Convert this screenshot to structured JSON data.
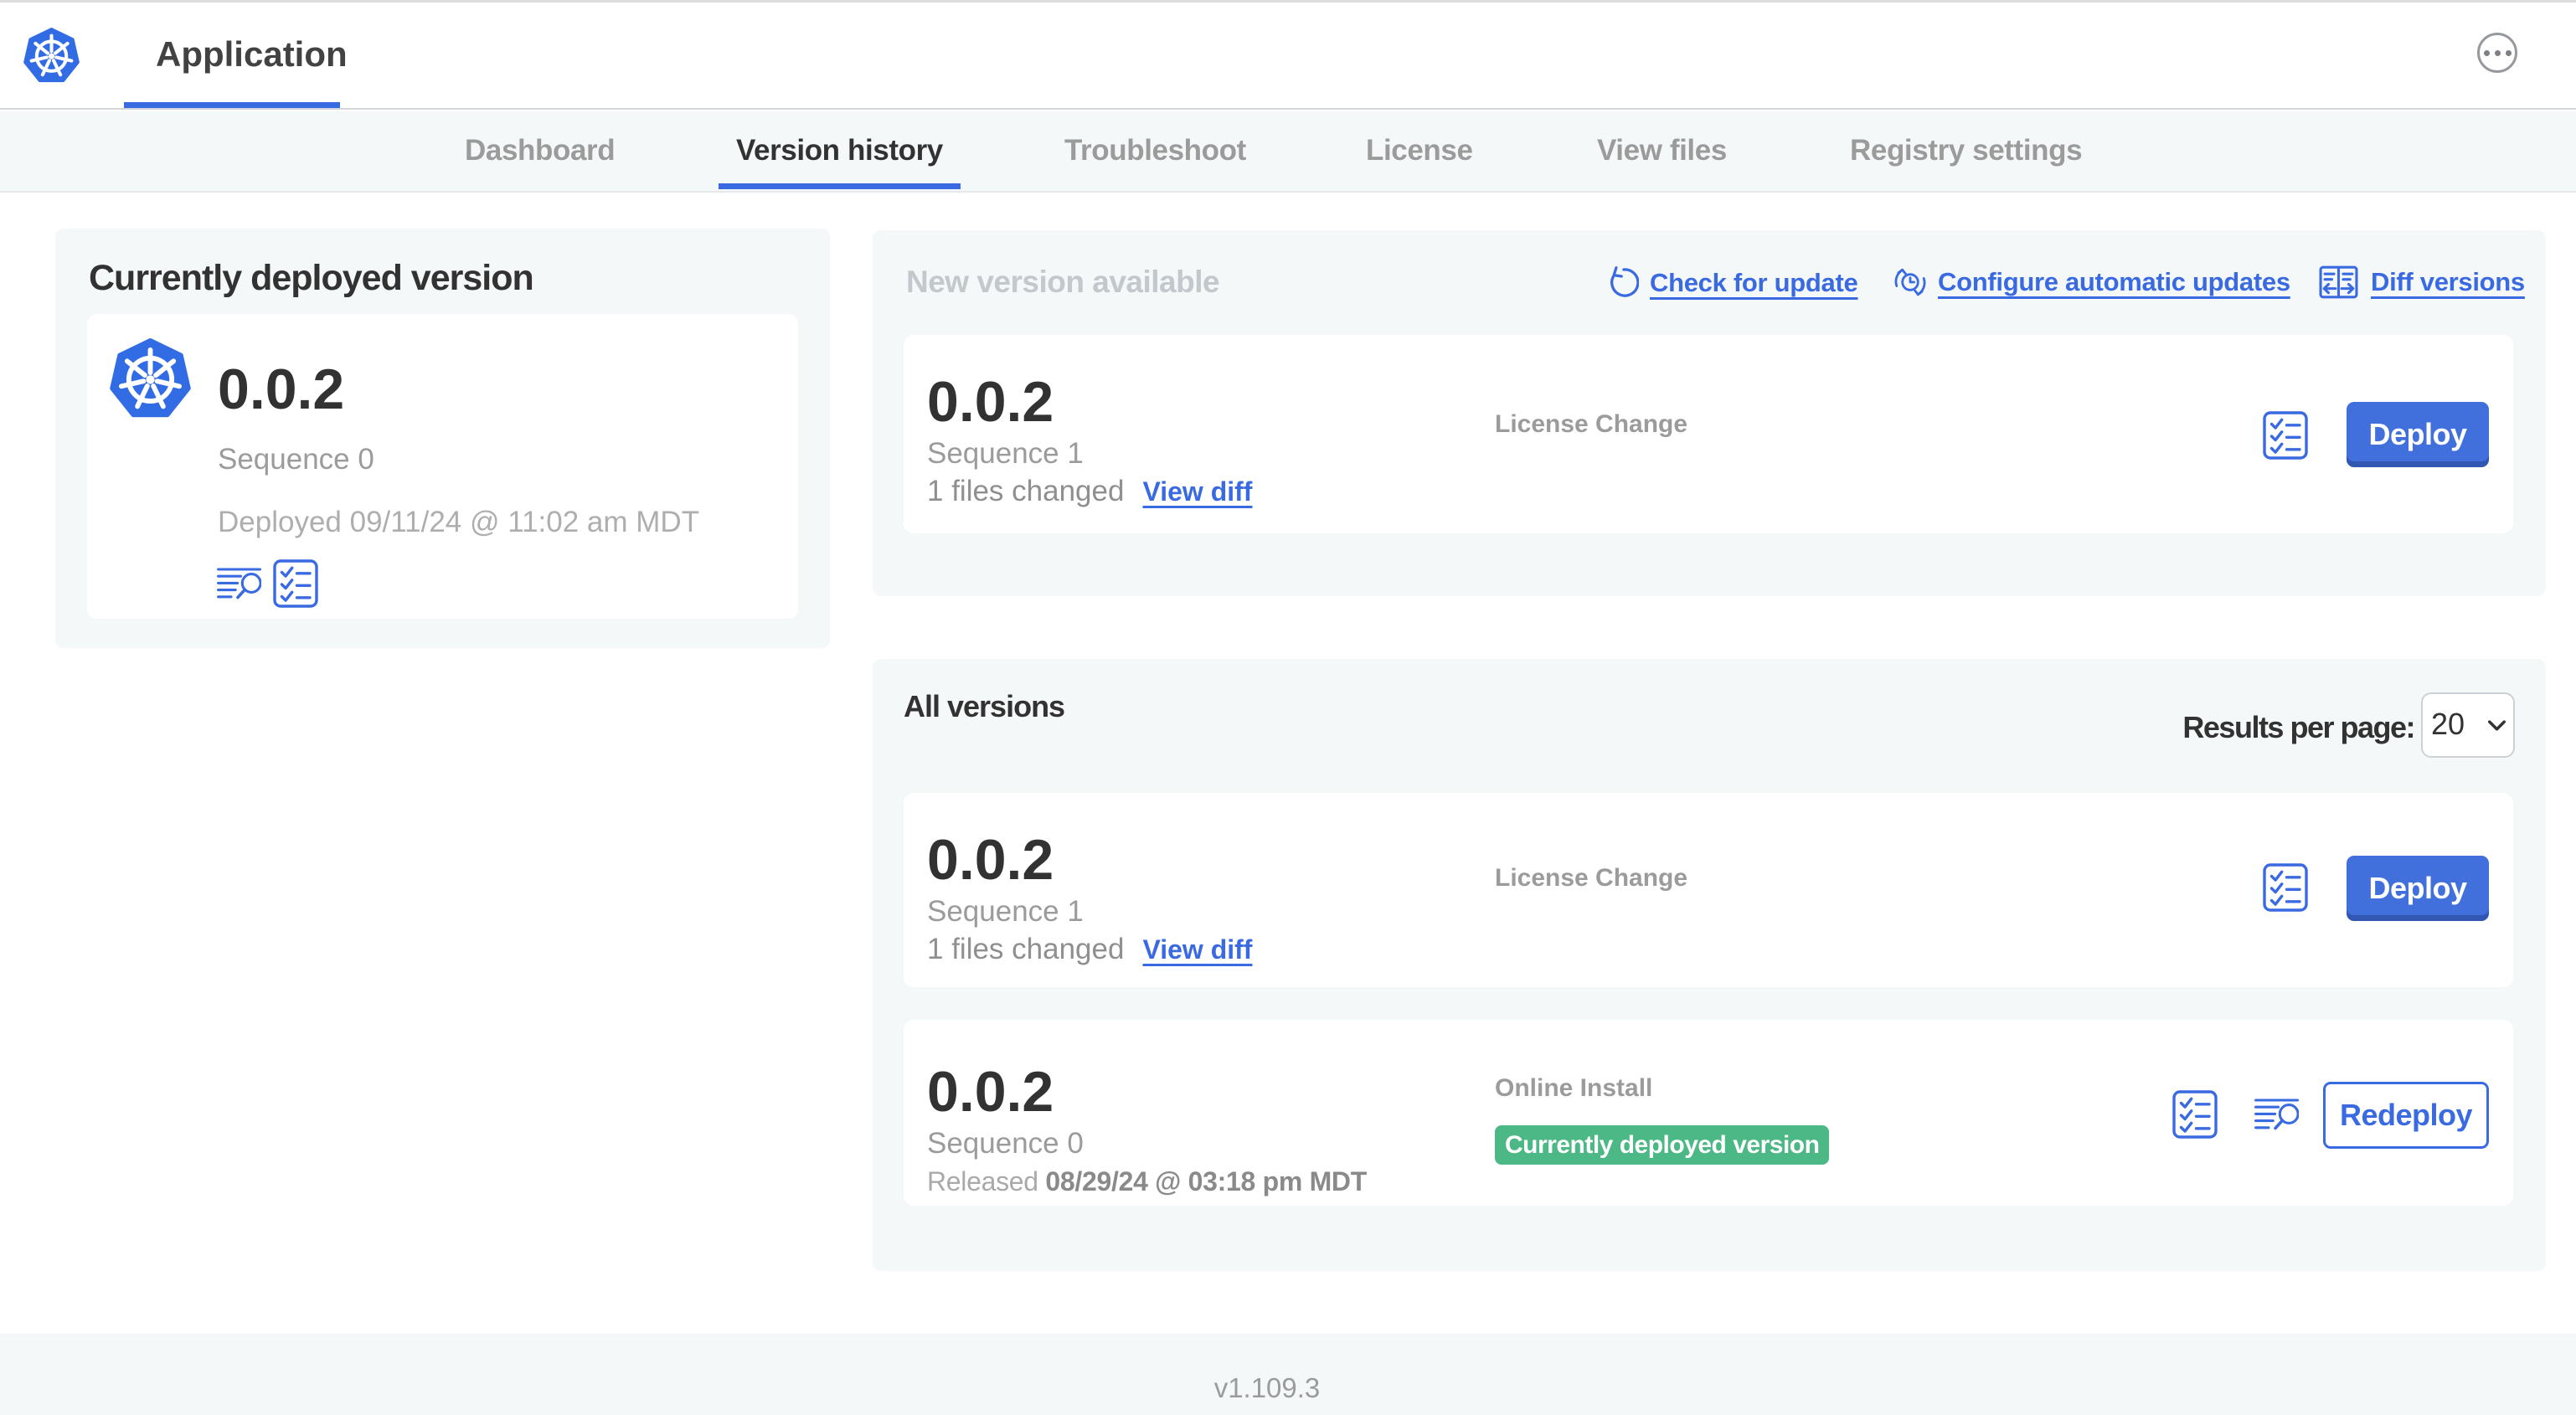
{
  "header": {
    "app_title": "Application",
    "more_menu": "more-options"
  },
  "tabs": [
    {
      "label": "Dashboard",
      "active": false
    },
    {
      "label": "Version history",
      "active": true
    },
    {
      "label": "Troubleshoot",
      "active": false
    },
    {
      "label": "License",
      "active": false
    },
    {
      "label": "View files",
      "active": false
    },
    {
      "label": "Registry settings",
      "active": false
    }
  ],
  "current_deployed": {
    "title": "Currently deployed version",
    "version": "0.0.2",
    "sequence": "Sequence 0",
    "deployed": "Deployed 09/11/24 @ 11:02 am MDT"
  },
  "new_version": {
    "title": "New version available",
    "check_for_update": "Check for update",
    "configure_updates": "Configure automatic updates",
    "diff_versions": "Diff versions",
    "card": {
      "version": "0.0.2",
      "sequence": "Sequence 1",
      "files_changed": "1 files changed",
      "view_diff": "View diff",
      "change_type": "License Change",
      "deploy": "Deploy"
    }
  },
  "all_versions": {
    "title": "All versions",
    "results_per_page_label": "Results per page:",
    "results_per_page_value": "20",
    "row1": {
      "version": "0.0.2",
      "sequence": "Sequence 1",
      "files_changed": "1 files changed",
      "view_diff": "View diff",
      "change_type": "License Change",
      "deploy": "Deploy"
    },
    "row2": {
      "version": "0.0.2",
      "sequence": "Sequence 0",
      "released_prefix": "Released ",
      "released_date": "08/29/24 @ 03:18 pm MDT",
      "change_type": "Online Install",
      "badge": "Currently deployed version",
      "redeploy": "Redeploy"
    }
  },
  "footer": {
    "version": "v1.109.3"
  },
  "colors": {
    "accent_blue": "#3a6ae1",
    "kubernetes_blue": "#326ce5",
    "badge_green": "#4cb885",
    "panel_gray": "#f5f8f9",
    "muted_text": "#9b9b9b"
  }
}
